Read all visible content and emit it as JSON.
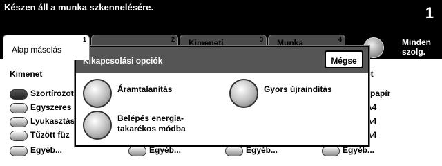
{
  "status": {
    "message": "Készen áll a munka szkennelésére.",
    "count": "1"
  },
  "tabs": [
    {
      "label": "Alap másolás",
      "num": "1"
    },
    {
      "label": "",
      "num": "2"
    },
    {
      "label": "Kimeneti",
      "num": "3"
    },
    {
      "label": "Munka",
      "num": "4"
    }
  ],
  "all_services": {
    "label_line1": "Minden",
    "label_line2": "szolg."
  },
  "background": {
    "col1_header": "Kimenet",
    "col4_header_fragment": "et",
    "col1_items": [
      "Szortírozott",
      "Egyszeres",
      "Lyukasztás",
      "Tűzött füz",
      "Egyéb..."
    ],
    "col2_items": [
      "Egyéb..."
    ],
    "col3_items": [
      "Egyéb..."
    ],
    "col4_items": [
      "papír",
      "A4",
      "A4",
      "A4",
      "Egyéb..."
    ]
  },
  "dialog": {
    "title": "Kikapcsolási opciók",
    "cancel_label": "Mégse",
    "power_off_label": "Áramtalanítás",
    "quick_restart_label": "Gyors újraindítás",
    "energy_saver_line1": "Belépés energia-",
    "energy_saver_line2": "takarékos módba"
  }
}
